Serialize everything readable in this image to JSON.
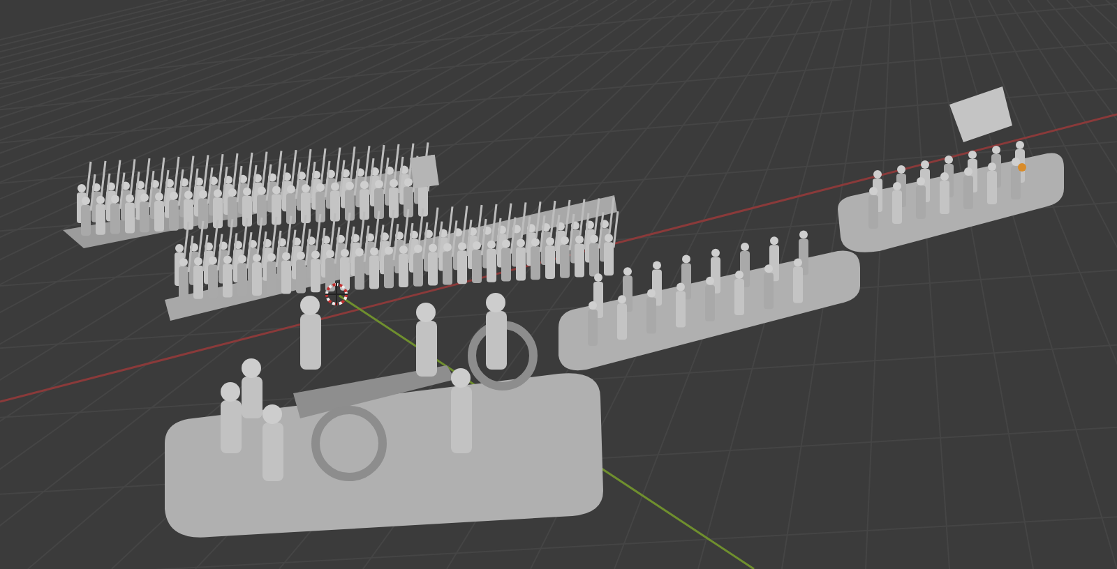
{
  "viewport": {
    "objects": [
      {
        "kind": "infantry"
      },
      {
        "kind": "gun"
      },
      {
        "kind": "skirmish"
      },
      {
        "kind": "crew"
      }
    ]
  }
}
